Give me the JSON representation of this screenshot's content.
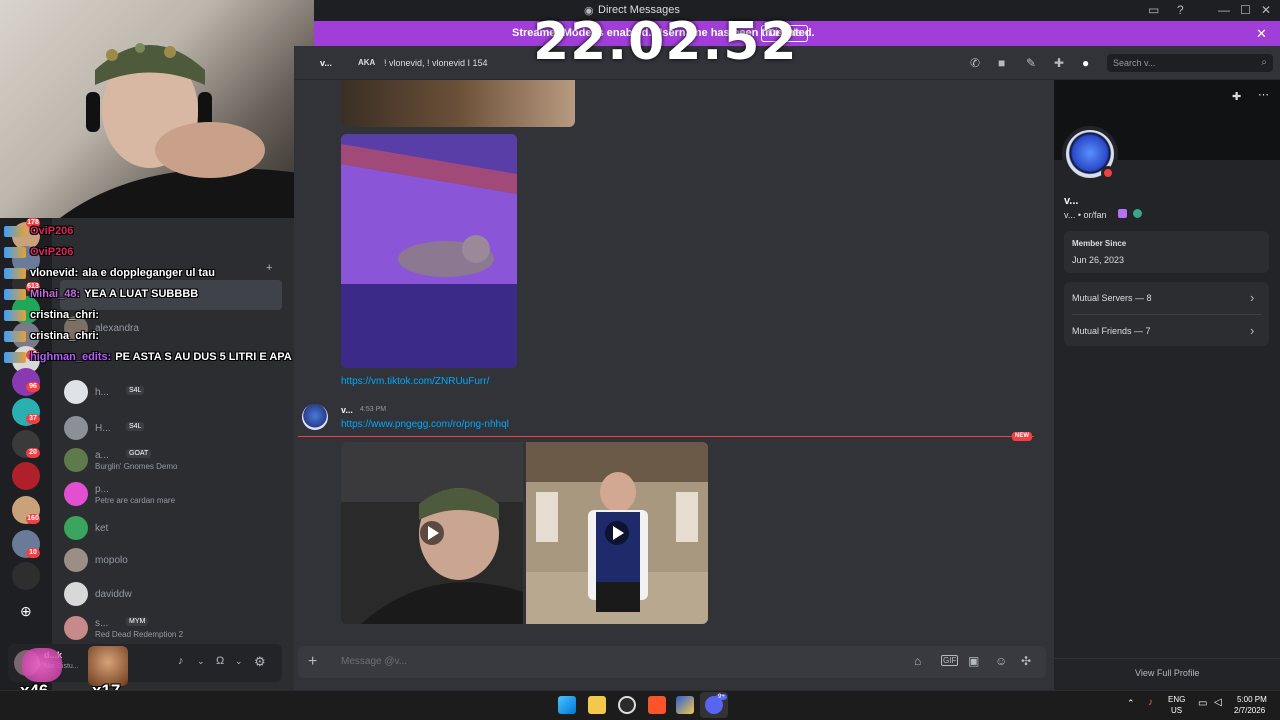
{
  "window": {
    "title": "Direct Messages"
  },
  "banner": {
    "text": "Streamer Mode is enabled. Username has been truncated.",
    "disable_label": "Disable"
  },
  "overlay": {
    "clock": "22.02.52",
    "bottom_counts": [
      "x46",
      "x17"
    ]
  },
  "guilds": {
    "badges": [
      "178",
      "613",
      "69",
      "96",
      "37",
      "20",
      "160",
      "10"
    ]
  },
  "chat_overlay": {
    "lines": [
      {
        "user": "OviP206",
        "user_color": "#e0245e",
        "message": ""
      },
      {
        "user": "OviP206",
        "user_color": "#e0245e",
        "message": ""
      },
      {
        "user": "vlonevid:",
        "user_color": "#ffffff",
        "message": "ala e doppleganger ul tau"
      },
      {
        "user": "Mihai_48:",
        "user_color": "#c56be0",
        "message": "YEA A LUAT SUBBBB"
      },
      {
        "user": "cristina_chri:",
        "user_color": "#ffffff",
        "message": ""
      },
      {
        "user": "cristina_chri:",
        "user_color": "#ffffff",
        "message": ""
      },
      {
        "user": "highman_edits:",
        "user_color": "#b55bff",
        "message": "PE ASTA S AU DUS 5 LITRI E APA"
      }
    ]
  },
  "dm_list": {
    "items": [
      {
        "name": "alexandra",
        "sub": "",
        "tag": "",
        "color": "#7b6f66"
      },
      {
        "name": "h...",
        "sub": "",
        "tag": "S4L",
        "color": "#dfe3e8"
      },
      {
        "name": "H...",
        "sub": "",
        "tag": "S4L",
        "color": "#8a9096"
      },
      {
        "name": "a...",
        "sub": "Burglin' Gnomes Demo",
        "tag": "GOAT",
        "color": "#5e7a4a"
      },
      {
        "name": "p...",
        "sub": "Petre are cardan mare",
        "tag": "",
        "color": "#e24fd0"
      },
      {
        "name": "ket",
        "sub": "",
        "tag": "",
        "color": "#3ba55d"
      },
      {
        "name": "mopolo",
        "sub": "",
        "tag": "",
        "color": "#9c8e84"
      },
      {
        "name": "daviddw",
        "sub": "",
        "tag": "",
        "color": "#d8d8d8"
      },
      {
        "name": "s...",
        "sub": "Red Dead Redemption 2",
        "tag": "MYM",
        "color": "#c68a8a"
      }
    ]
  },
  "user_panel": {
    "name": "d...k",
    "status": "Not Distu..."
  },
  "header": {
    "name": "v...",
    "aka_label": "AKA",
    "aka_value": "! vlonevid, ! vlonevid I 154",
    "search_placeholder": "Search v..."
  },
  "messages": {
    "link1": "https://vm.tiktok.com/ZNRUuFurr/",
    "author": "v...",
    "time": "4:53 PM",
    "link2": "https://www.pngegg.com/ro/png-nhhql",
    "new_label": "NEW"
  },
  "composer": {
    "placeholder": "Message @v..."
  },
  "profile": {
    "name": "v...",
    "handle": "v... • or/fan",
    "member_since_label": "Member Since",
    "member_since": "Jun 26, 2023",
    "mutual_servers": "Mutual Servers — 8",
    "mutual_friends": "Mutual Friends — 7",
    "view_full": "View Full Profile"
  },
  "taskbar": {
    "lang1": "ENG",
    "lang2": "US",
    "time": "5:00 PM",
    "date": "2/7/2026",
    "discord_badge": "9+"
  },
  "colors": {
    "accent": "#a13dd9",
    "link": "#00a8fc",
    "danger": "#f23f43",
    "bg": "#313338"
  }
}
